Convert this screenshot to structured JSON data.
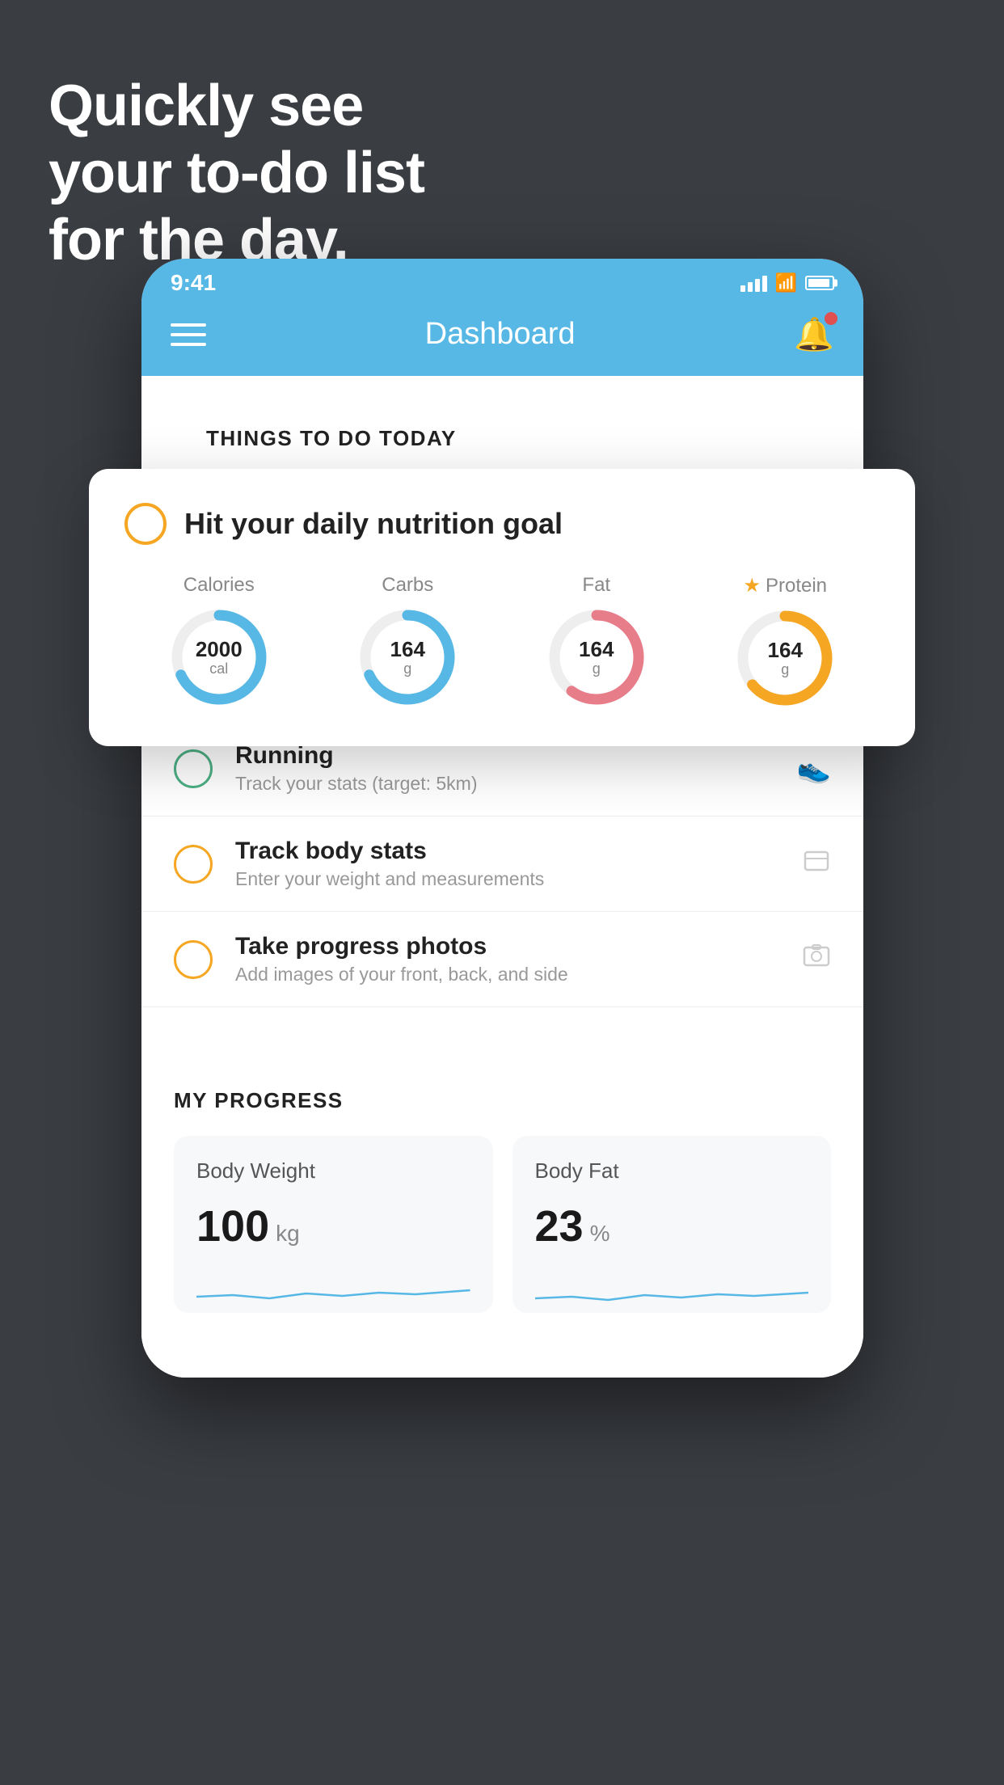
{
  "headline": {
    "line1": "Quickly see",
    "line2": "your to-do list",
    "line3": "for the day."
  },
  "status_bar": {
    "time": "9:41"
  },
  "header": {
    "title": "Dashboard"
  },
  "things_to_do": {
    "section_label": "THINGS TO DO TODAY"
  },
  "nutrition_card": {
    "title": "Hit your daily nutrition goal",
    "macros": [
      {
        "label": "Calories",
        "value": "2000",
        "unit": "cal",
        "color": "blue",
        "starred": false
      },
      {
        "label": "Carbs",
        "value": "164",
        "unit": "g",
        "color": "blue",
        "starred": false
      },
      {
        "label": "Fat",
        "value": "164",
        "unit": "g",
        "color": "pink",
        "starred": false
      },
      {
        "label": "Protein",
        "value": "164",
        "unit": "g",
        "color": "yellow",
        "starred": true
      }
    ]
  },
  "todo_items": [
    {
      "title": "Running",
      "subtitle": "Track your stats (target: 5km)",
      "status": "green",
      "icon": "shoe"
    },
    {
      "title": "Track body stats",
      "subtitle": "Enter your weight and measurements",
      "status": "yellow",
      "icon": "scale"
    },
    {
      "title": "Take progress photos",
      "subtitle": "Add images of your front, back, and side",
      "status": "yellow",
      "icon": "photo"
    }
  ],
  "progress": {
    "section_label": "MY PROGRESS",
    "cards": [
      {
        "title": "Body Weight",
        "value": "100",
        "unit": "kg"
      },
      {
        "title": "Body Fat",
        "value": "23",
        "unit": "%"
      }
    ]
  }
}
